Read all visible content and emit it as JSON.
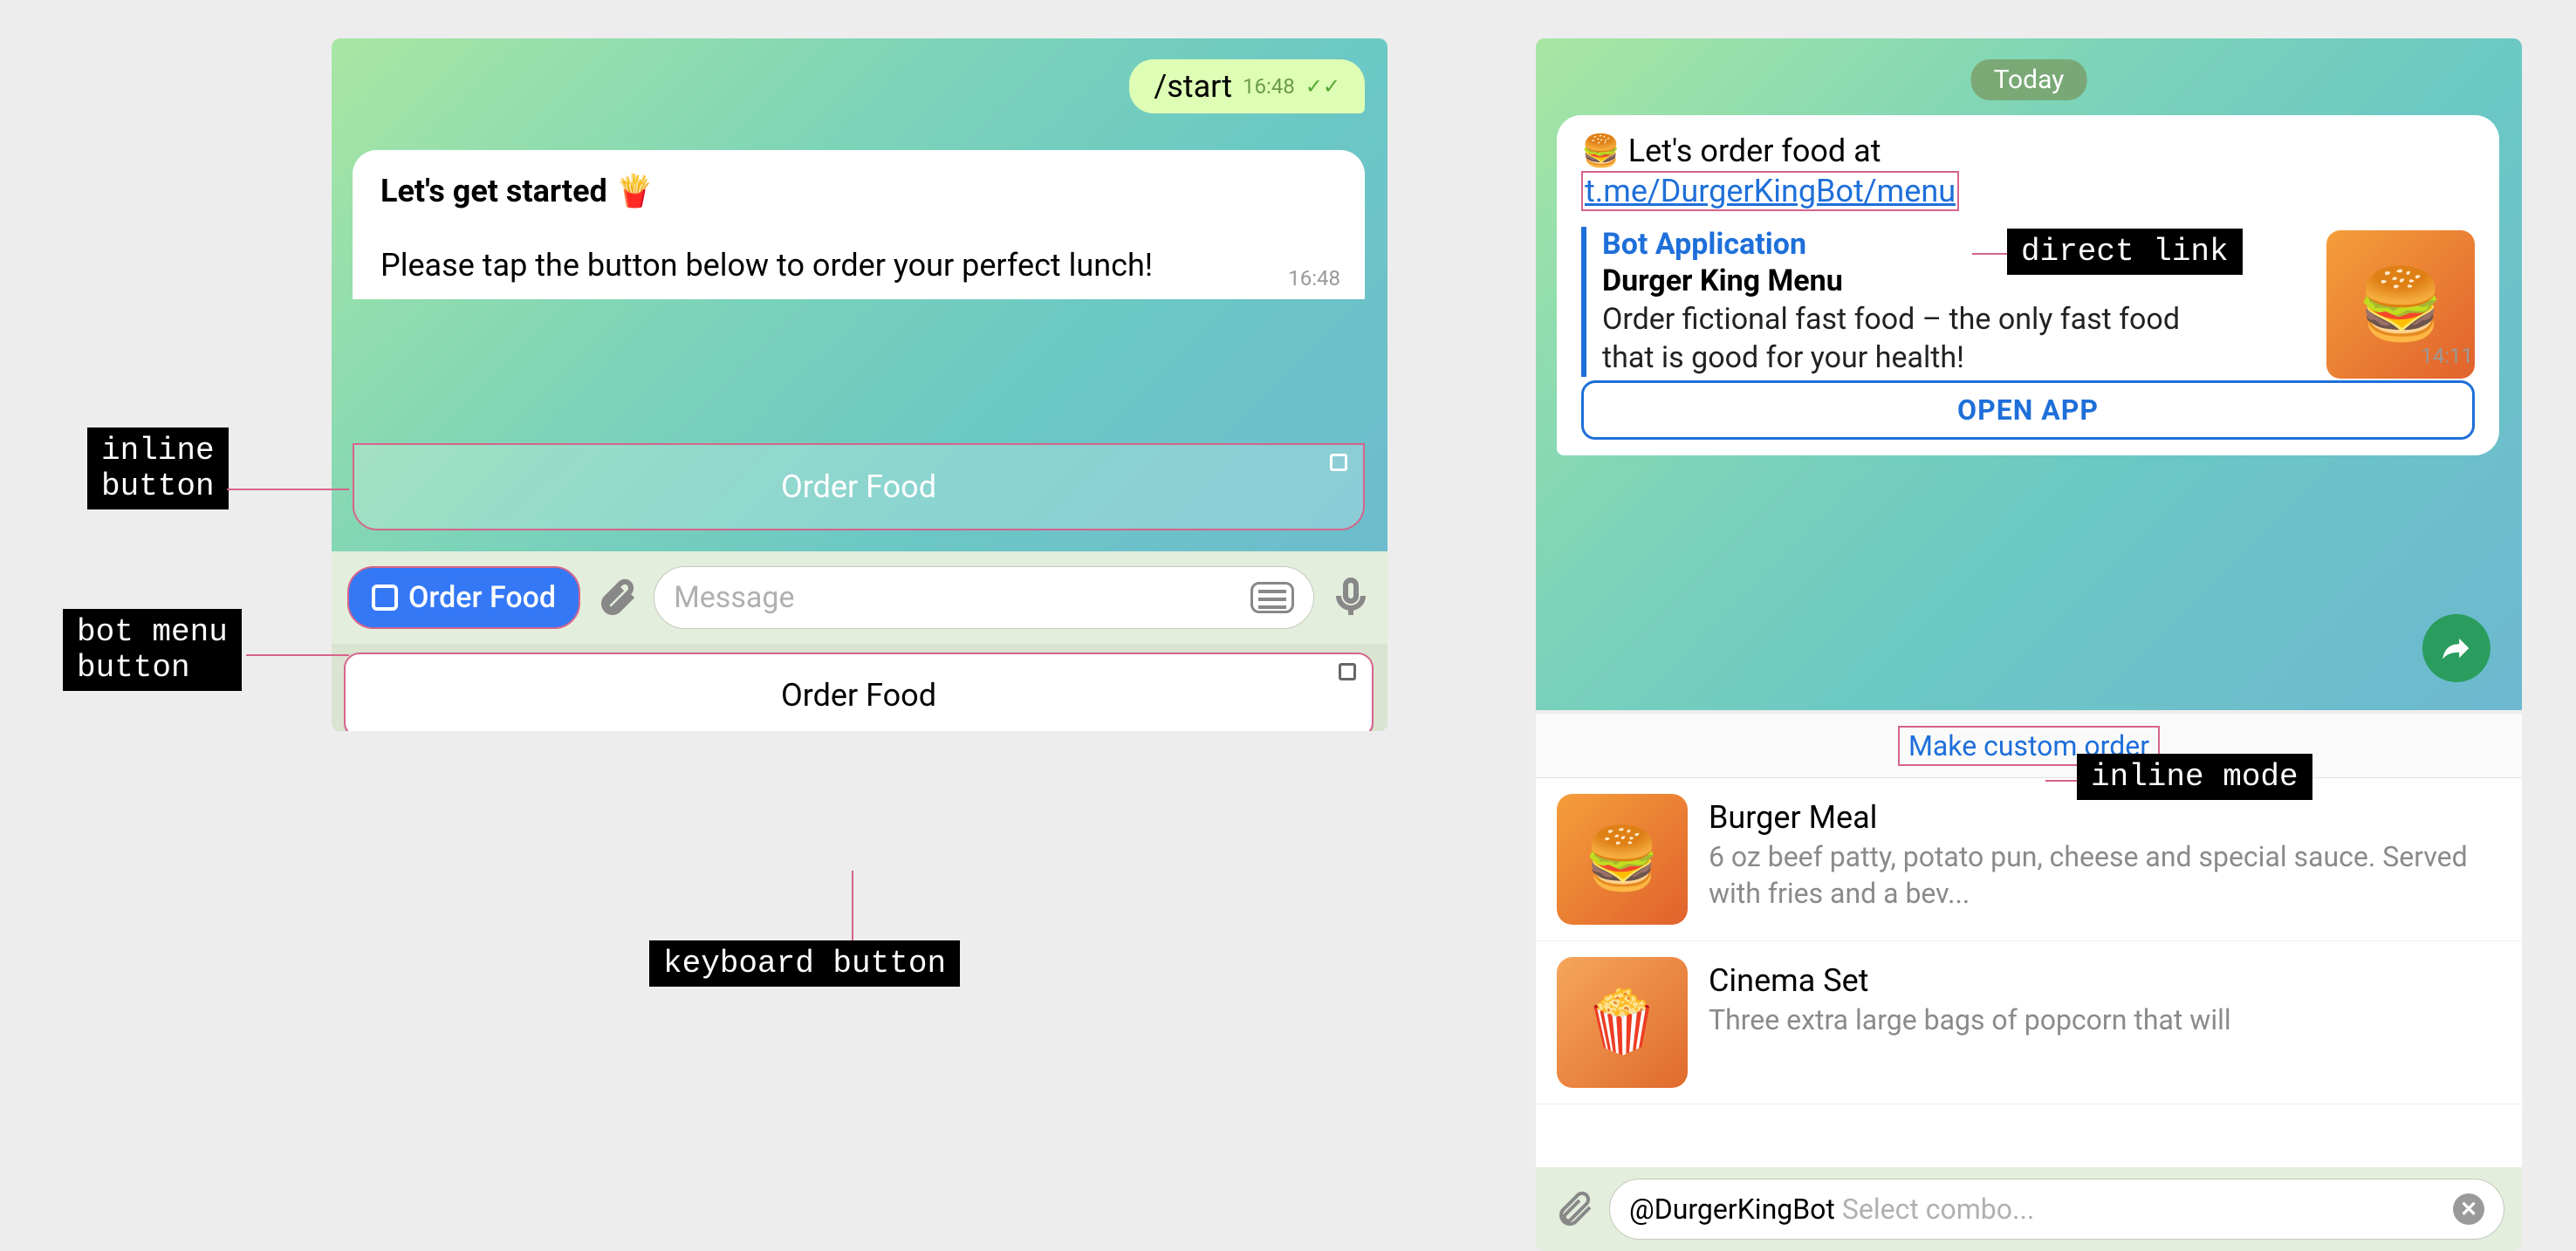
{
  "left": {
    "outgoing": {
      "text": "/start",
      "time": "16:48"
    },
    "incoming": {
      "heading": "Let's get started 🍟",
      "body": "Please tap the button below to order your perfect lunch!",
      "time": "16:48"
    },
    "inline_button": {
      "label": "Order Food"
    },
    "input": {
      "menu_button_label": "Order Food",
      "placeholder": "Message"
    },
    "keyboard_button": {
      "label": "Order Food"
    }
  },
  "right": {
    "date": "Today",
    "message": {
      "text_prefix": "🍔 Let's order food at",
      "link_text": "t.me/DurgerKingBot/menu",
      "preview": {
        "label": "Bot Application",
        "title": "Durger King Menu",
        "desc": "Order fictional fast food – the only fast food that is good for your health!"
      },
      "time": "14:11",
      "open_button": "OPEN APP"
    },
    "quick_link": "Make custom order",
    "results": [
      {
        "title": "Burger Meal",
        "desc": "6 oz beef patty, potato pun, cheese and special sauce. Served with fries and a bev...",
        "icon": "🍔"
      },
      {
        "title": "Cinema Set",
        "desc": "Three extra large bags of popcorn that will",
        "icon": "🍿"
      }
    ],
    "input": {
      "mention": "@DurgerKingBot",
      "placeholder": "Select combo..."
    }
  },
  "annotations": {
    "inline_button": "inline\nbutton",
    "bot_menu_button": "bot menu\nbutton",
    "keyboard_button": "keyboard button",
    "direct_link": "direct link",
    "inline_mode": "inline mode"
  }
}
